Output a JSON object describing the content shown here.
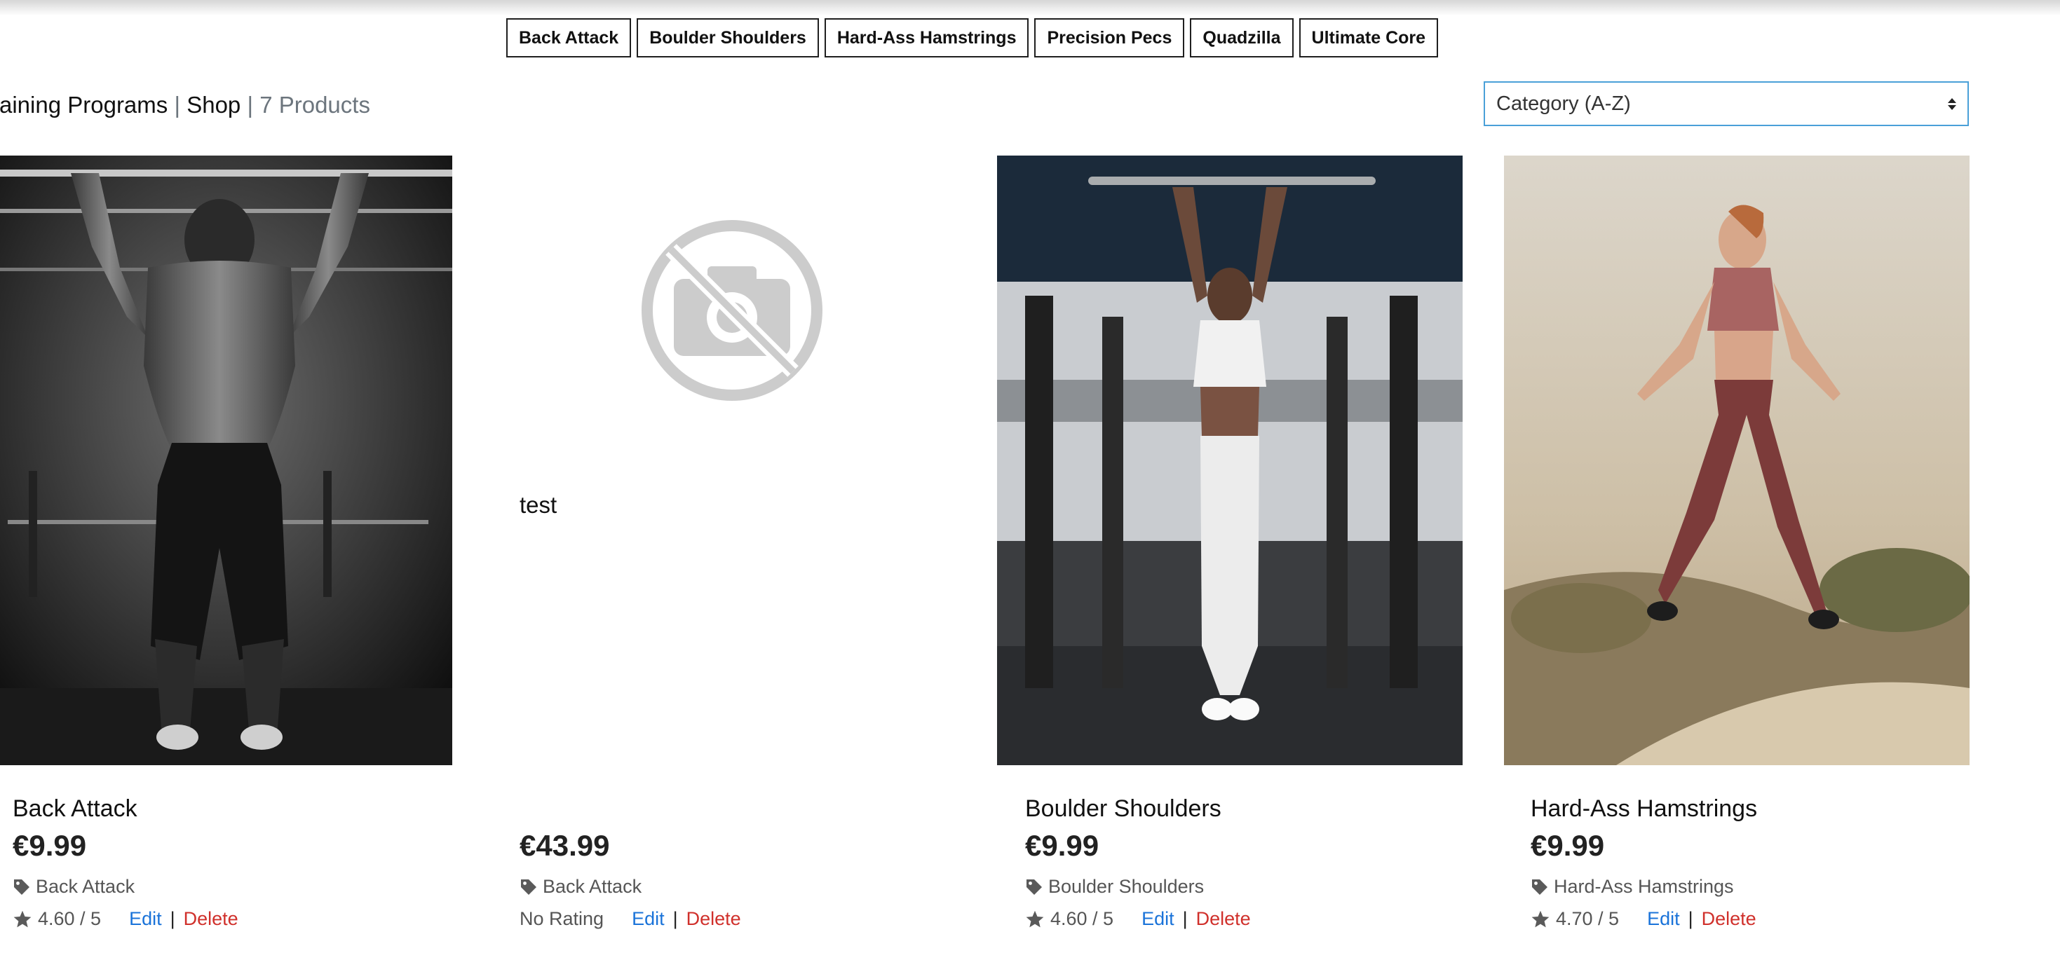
{
  "category_buttons": [
    "Back Attack",
    "Boulder Shoulders",
    "Hard-Ass Hamstrings",
    "Precision Pecs",
    "Quadzilla",
    "Ultimate Core"
  ],
  "breadcrumb": {
    "section": "raining Programs",
    "separator": "|",
    "page": "Shop",
    "count": "7 Products"
  },
  "sort": {
    "selected": "Category (A-Z)"
  },
  "products": [
    {
      "title": "Back Attack",
      "price": "€9.99",
      "category": "Back Attack",
      "rating": "4.60 / 5",
      "edit": "Edit",
      "separator": "|",
      "delete": "Delete"
    },
    {
      "title": "",
      "body_text": "test",
      "price": "€43.99",
      "category": "Back Attack",
      "rating": "No Rating",
      "edit": "Edit",
      "separator": "|",
      "delete": "Delete"
    },
    {
      "title": "Boulder Shoulders",
      "price": "€9.99",
      "category": "Boulder Shoulders",
      "rating": "4.60 / 5",
      "edit": "Edit",
      "separator": "|",
      "delete": "Delete"
    },
    {
      "title": "Hard-Ass Hamstrings",
      "price": "€9.99",
      "category": "Hard-Ass Hamstrings",
      "rating": "4.70 / 5",
      "edit": "Edit",
      "separator": "|",
      "delete": "Delete"
    }
  ],
  "icons": {
    "category": "tag-icon",
    "rating": "star-icon",
    "no_image": "no-photo-icon"
  },
  "colors": {
    "link": "#1a73d9",
    "delete": "#d0302b",
    "sort_border": "#4aa0d8"
  }
}
